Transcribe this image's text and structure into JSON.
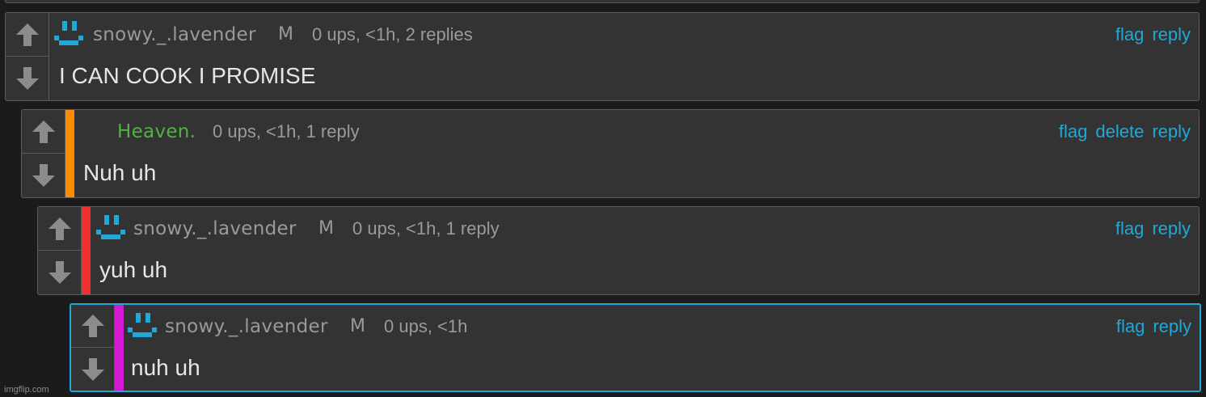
{
  "comments": [
    {
      "username": "snowy._.lavender",
      "badge": "M",
      "meta": "0 ups, <1h, 2 replies",
      "body": "I CAN COOK I PROMISE",
      "actions": {
        "flag": "flag",
        "reply": "reply"
      }
    },
    {
      "username": "Heaven.",
      "meta": "0 ups, <1h, 1 reply",
      "body": "Nuh uh",
      "depth_color": "#ff8c00",
      "username_color": "#4fb43f",
      "actions": {
        "flag": "flag",
        "delete": "delete",
        "reply": "reply"
      }
    },
    {
      "username": "snowy._.lavender",
      "badge": "M",
      "meta": "0 ups, <1h, 1 reply",
      "body": "yuh uh",
      "depth_color": "#f03030",
      "actions": {
        "flag": "flag",
        "reply": "reply"
      }
    },
    {
      "username": "snowy._.lavender",
      "badge": "M",
      "meta": "0 ups, <1h",
      "body": "nuh uh",
      "depth_color": "#d21ad2",
      "highlighted": true,
      "actions": {
        "flag": "flag",
        "reply": "reply"
      }
    }
  ],
  "icons": {
    "upvote": "arrow-up-icon",
    "downvote": "arrow-down-icon",
    "avatar": "smiley-avatar-icon"
  },
  "colors": {
    "link": "#1fa8d8",
    "avatar": "#1fa8d8",
    "panel": "#333333",
    "background": "#1b1b1b"
  },
  "watermark": "imgflip.com"
}
